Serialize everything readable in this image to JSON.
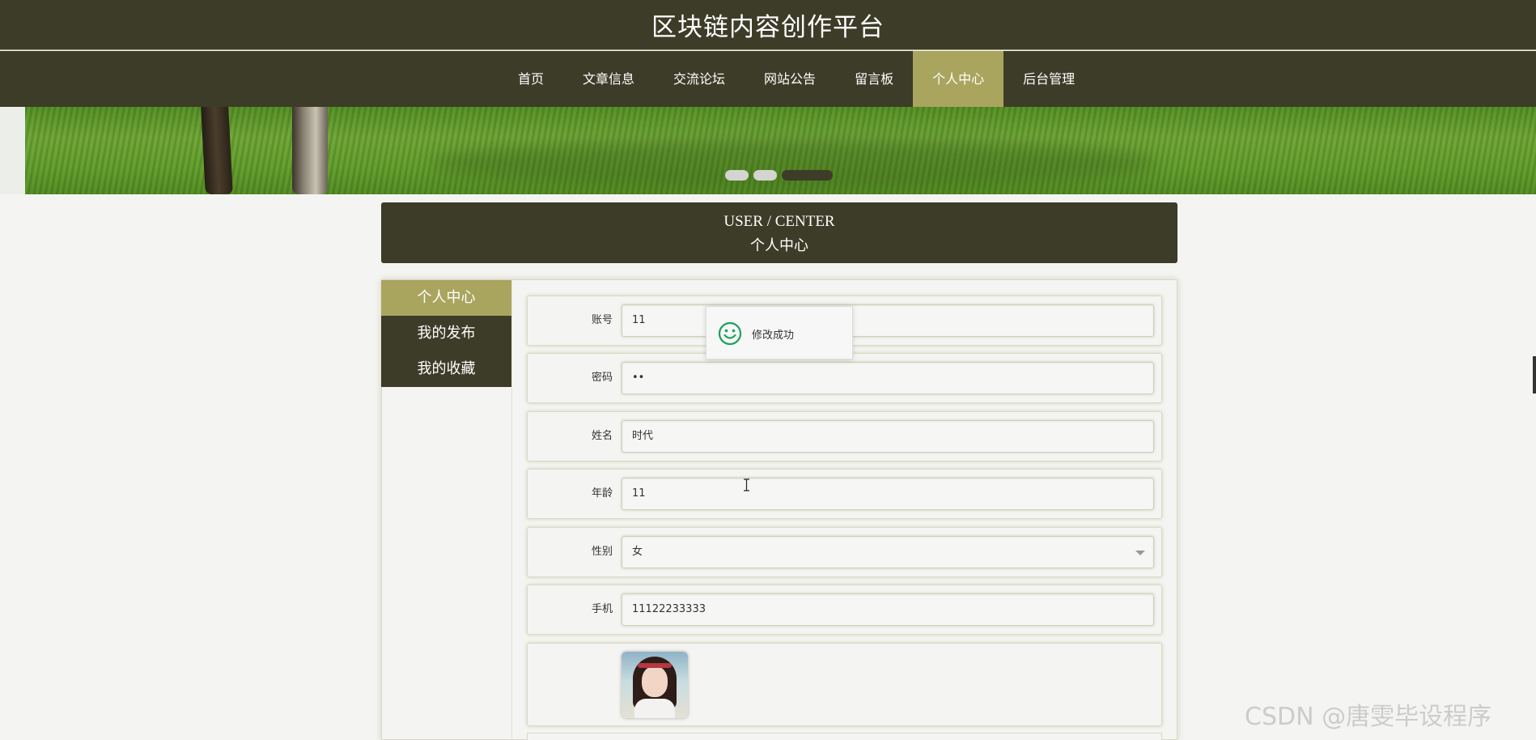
{
  "site": {
    "title": "区块链内容创作平台"
  },
  "nav": {
    "items": [
      {
        "label": "首页"
      },
      {
        "label": "文章信息"
      },
      {
        "label": "交流论坛"
      },
      {
        "label": "网站公告"
      },
      {
        "label": "留言板"
      },
      {
        "label": "个人中心",
        "active": true
      },
      {
        "label": "后台管理"
      }
    ]
  },
  "banner": {
    "slide_count": 3,
    "active_slide": 3
  },
  "center_header": {
    "english": "USER / CENTER",
    "chinese": "个人中心"
  },
  "side_menu": {
    "items": [
      {
        "label": "个人中心",
        "active": true
      },
      {
        "label": "我的发布"
      },
      {
        "label": "我的收藏"
      }
    ]
  },
  "form": {
    "account": {
      "label": "账号",
      "value": "11"
    },
    "password": {
      "label": "密码",
      "value": "••"
    },
    "name": {
      "label": "姓名",
      "value": "时代"
    },
    "age": {
      "label": "年龄",
      "value": "11"
    },
    "gender": {
      "label": "性别",
      "value": "女"
    },
    "phone": {
      "label": "手机",
      "value": "11122233333"
    }
  },
  "toast": {
    "message": "修改成功"
  },
  "watermark": "CSDN @唐雯毕设程序",
  "colors": {
    "primary_dark": "#3d3c28",
    "accent": "#a9a55e",
    "background": "#f4f4f2"
  },
  "icons": {
    "toast": "smile-icon",
    "select": "chevron-down-icon",
    "cursor": "text-cursor-icon"
  }
}
